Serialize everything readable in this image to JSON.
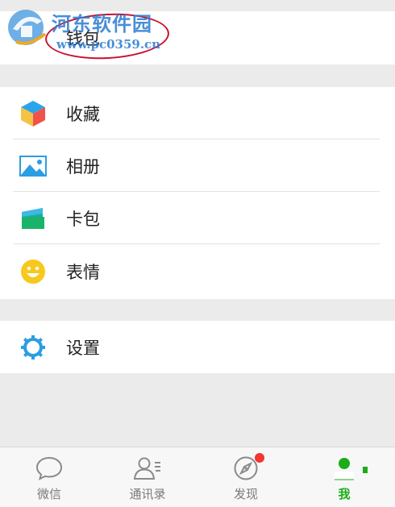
{
  "watermark": {
    "title": "河东软件园",
    "url": "www.pc0359.cn"
  },
  "wallet": {
    "label": "钱包"
  },
  "menu": {
    "items": [
      {
        "label": "收藏",
        "icon": "favorites-cube-icon"
      },
      {
        "label": "相册",
        "icon": "album-picture-icon"
      },
      {
        "label": "卡包",
        "icon": "card-wallet-icon"
      },
      {
        "label": "表情",
        "icon": "sticker-smiley-icon"
      }
    ]
  },
  "settings": {
    "label": "设置",
    "icon": "gear-icon"
  },
  "tabbar": {
    "tabs": [
      {
        "label": "微信",
        "icon": "chat-bubble-icon",
        "active": false
      },
      {
        "label": "通讯录",
        "icon": "contacts-icon",
        "active": false
      },
      {
        "label": "发现",
        "icon": "compass-icon",
        "active": false,
        "badge": true
      },
      {
        "label": "我",
        "icon": "person-icon",
        "active": true
      }
    ]
  },
  "colors": {
    "active_green": "#1aad19",
    "badge_red": "#f43530",
    "annotation_red": "#c8102e",
    "watermark_blue": "#2a7bd1"
  }
}
